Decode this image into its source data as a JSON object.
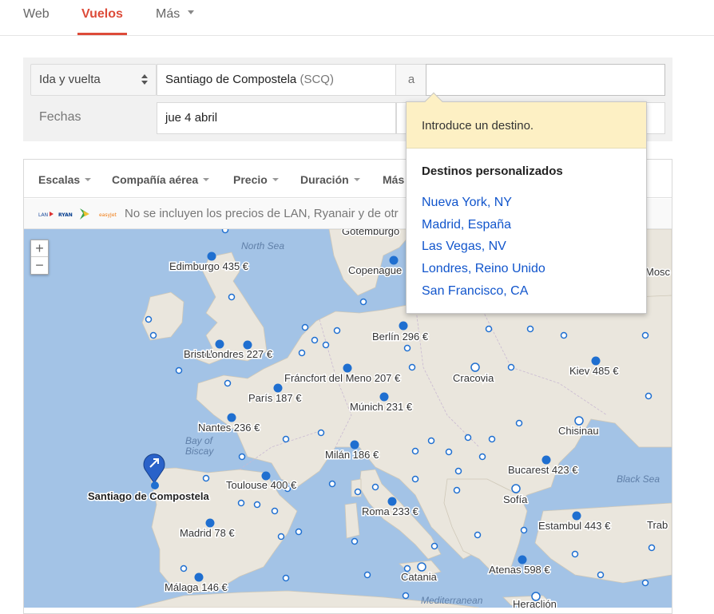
{
  "nav": {
    "tabs": [
      {
        "label": "Web"
      },
      {
        "label": "Vuelos"
      },
      {
        "label": "Más"
      }
    ]
  },
  "search": {
    "trip_type": "Ida y vuelta",
    "origin_city": "Santiago de Compostela",
    "origin_code": "(SCQ)",
    "to_label": "a",
    "destination_value": "",
    "dates_label": "Fechas",
    "depart_date": "jue 4 abril",
    "return_date": ""
  },
  "filters": [
    "Escalas",
    "Compañía aérea",
    "Precio",
    "Duración",
    "Más"
  ],
  "notice": "No se incluyen los precios de LAN, Ryanair y de otr",
  "map": {
    "origin": "Santiago de Compostela",
    "sea_labels": [
      "North Sea",
      "Bay of Biscay",
      "Black Sea",
      "Mediterranean"
    ],
    "cities": [
      {
        "label": "Gotemburgo"
      },
      {
        "label": "Edimburgo 435 €"
      },
      {
        "label": "Copenague"
      },
      {
        "label": "Mosc"
      },
      {
        "label": "Berlín 296 €"
      },
      {
        "label": "Bristol"
      },
      {
        "label": "Londres 227 €"
      },
      {
        "label": "Fráncfort del Meno 207 €"
      },
      {
        "label": "Cracovia"
      },
      {
        "label": "Kiev 485 €"
      },
      {
        "label": "París 187 €"
      },
      {
        "label": "Múnich 231 €"
      },
      {
        "label": "Nantes 236 €"
      },
      {
        "label": "Chisinau"
      },
      {
        "label": "Milán 186 €"
      },
      {
        "label": "Bucarest 423 €"
      },
      {
        "label": "Toulouse 400 €"
      },
      {
        "label": "Sofía"
      },
      {
        "label": "Roma 233 €"
      },
      {
        "label": "Madrid 78 €"
      },
      {
        "label": "Estambul 443 €"
      },
      {
        "label": "Trab"
      },
      {
        "label": "Atenas 598 €"
      },
      {
        "label": "Catania"
      },
      {
        "label": "Málaga 146 €"
      },
      {
        "label": "Heraclión"
      }
    ],
    "zoom_in": "+",
    "zoom_out": "−"
  },
  "popup": {
    "hint": "Introduce un destino.",
    "title": "Destinos personalizados",
    "destinations": [
      "Nueva York, NY",
      "Madrid, España",
      "Las Vegas, NV",
      "Londres, Reino Unido",
      "San Francisco, CA"
    ]
  },
  "colors": {
    "accent": "#dd4b39",
    "link": "#1155cc",
    "sea": "#a3c3e6",
    "land": "#eae6dd",
    "dot": "#1f6fd0",
    "hint_bg": "#fdf0c4"
  }
}
